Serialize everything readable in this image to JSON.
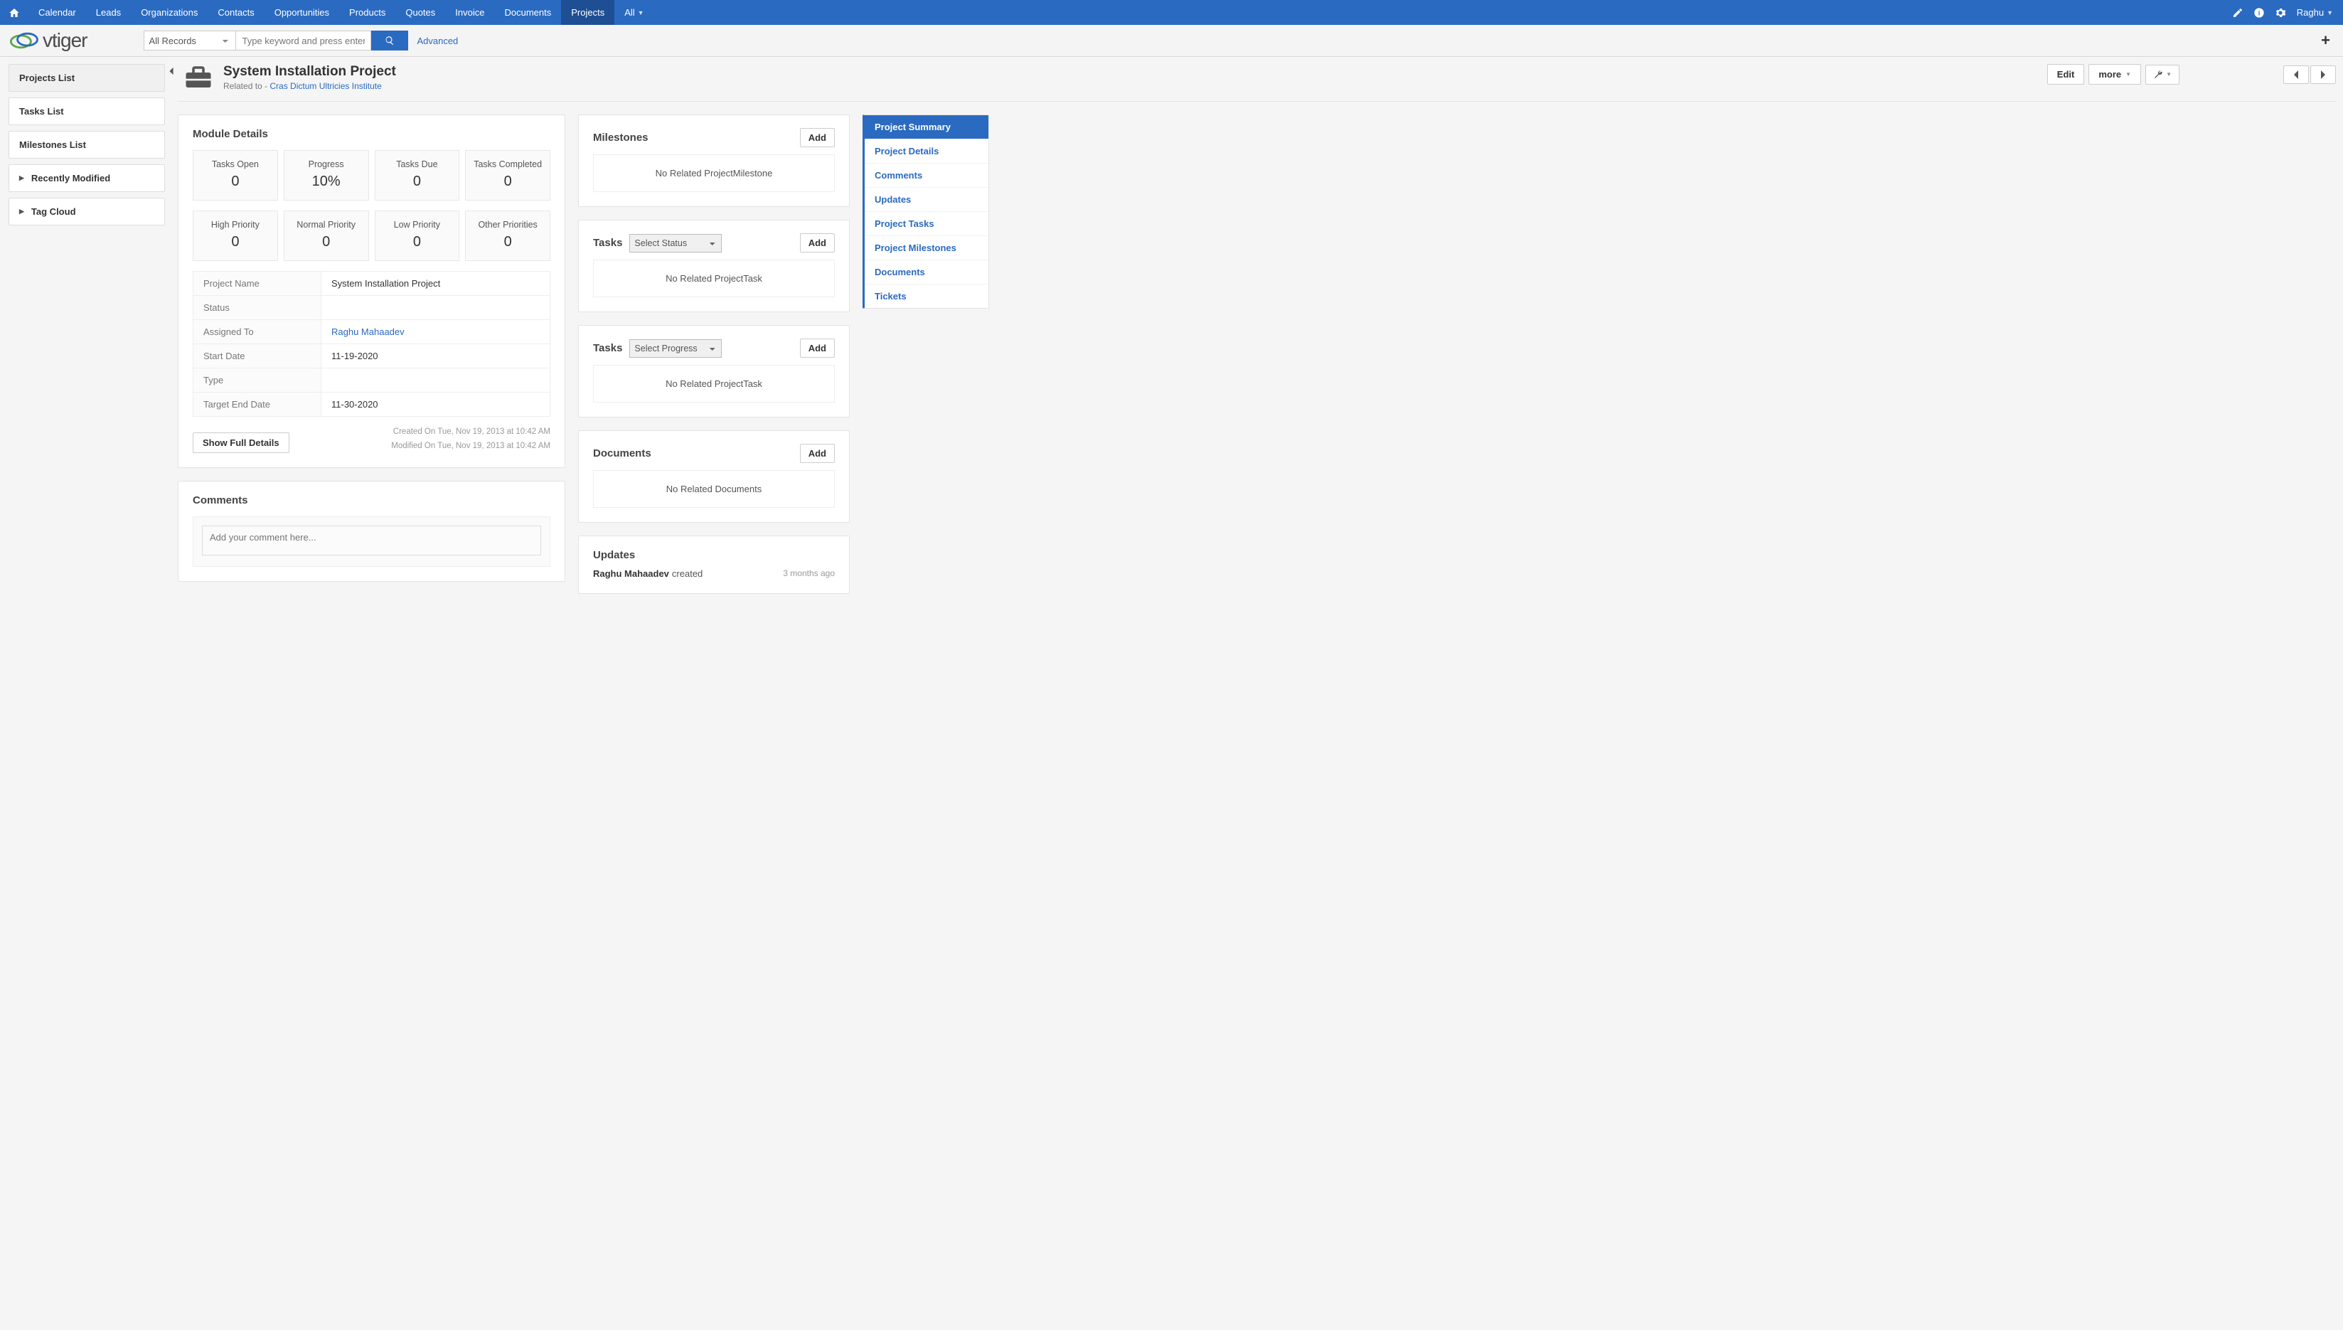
{
  "topnav": {
    "items": [
      "Calendar",
      "Leads",
      "Organizations",
      "Contacts",
      "Opportunities",
      "Products",
      "Quotes",
      "Invoice",
      "Documents",
      "Projects",
      "All"
    ],
    "active": "Projects",
    "user": "Raghu"
  },
  "searchbar": {
    "scope": "All Records",
    "placeholder": "Type keyword and press enter",
    "advanced": "Advanced"
  },
  "logo_text": "vtiger",
  "left_sidebar": {
    "lists": [
      "Projects List",
      "Tasks List",
      "Milestones List"
    ],
    "accordions": [
      "Recently Modified",
      "Tag Cloud"
    ]
  },
  "header": {
    "title": "System Installation Project",
    "related_label": "Related to -",
    "related_link": "Cras Dictum Ultricies Institute",
    "edit": "Edit",
    "more": "more"
  },
  "module_details": {
    "heading": "Module Details",
    "stats_row1": [
      {
        "label": "Tasks Open",
        "value": "0"
      },
      {
        "label": "Progress",
        "value": "10%"
      },
      {
        "label": "Tasks Due",
        "value": "0"
      },
      {
        "label": "Tasks Completed",
        "value": "0"
      }
    ],
    "stats_row2": [
      {
        "label": "High Priority",
        "value": "0"
      },
      {
        "label": "Normal Priority",
        "value": "0"
      },
      {
        "label": "Low Priority",
        "value": "0"
      },
      {
        "label": "Other Priorities",
        "value": "0"
      }
    ],
    "fields": [
      {
        "label": "Project Name",
        "value": "System Installation Project",
        "link": false
      },
      {
        "label": "Status",
        "value": "",
        "link": false
      },
      {
        "label": "Assigned To",
        "value": "Raghu Mahaadev",
        "link": true
      },
      {
        "label": "Start Date",
        "value": "11-19-2020",
        "link": false
      },
      {
        "label": "Type",
        "value": "",
        "link": false
      },
      {
        "label": "Target End Date",
        "value": "11-30-2020",
        "link": false
      }
    ],
    "show_full": "Show Full Details",
    "created": "Created On Tue, Nov 19, 2013 at 10:42 AM",
    "modified": "Modified On Tue, Nov 19, 2013 at 10:42 AM"
  },
  "comments": {
    "heading": "Comments",
    "placeholder": "Add your comment here..."
  },
  "related_panels": {
    "milestones": {
      "title": "Milestones",
      "empty": "No Related ProjectMilestone",
      "add": "Add"
    },
    "tasks_status": {
      "title": "Tasks",
      "select": "Select Status",
      "empty": "No Related ProjectTask",
      "add": "Add"
    },
    "tasks_progress": {
      "title": "Tasks",
      "select": "Select Progress",
      "empty": "No Related ProjectTask",
      "add": "Add"
    },
    "documents": {
      "title": "Documents",
      "empty": "No Related Documents",
      "add": "Add"
    },
    "updates": {
      "title": "Updates",
      "who": "Raghu Mahaadev",
      "action": "created",
      "when": "3 months ago"
    }
  },
  "sidenav": {
    "items": [
      "Project Summary",
      "Project Details",
      "Comments",
      "Updates",
      "Project Tasks",
      "Project Milestones",
      "Documents",
      "Tickets"
    ],
    "active": "Project Summary"
  }
}
